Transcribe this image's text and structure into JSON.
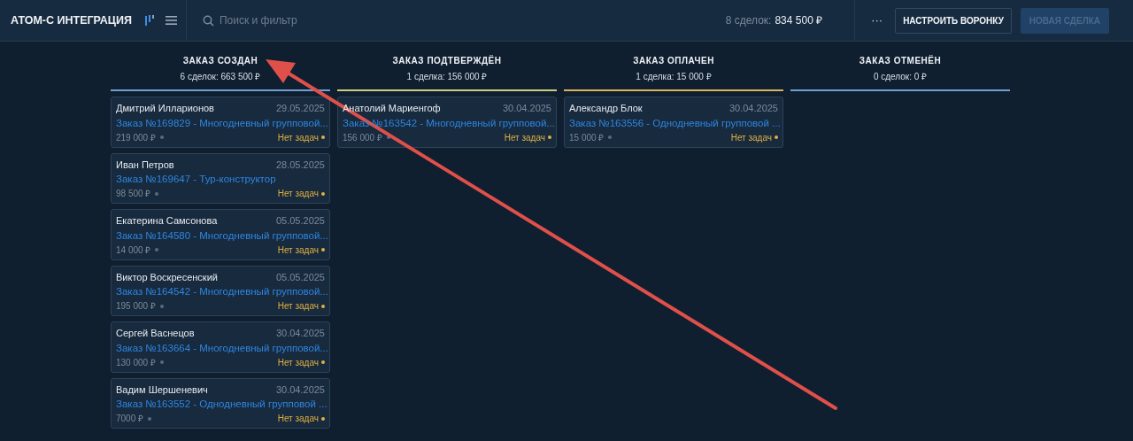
{
  "header": {
    "title": "АТОМ-С ИНТЕГРАЦИЯ",
    "search": {
      "placeholder": "Поиск и фильтр"
    },
    "summary_label": "8 сделок:",
    "summary_value": "834 500 ₽",
    "more": "···",
    "buttons": [
      {
        "label": "НАСТРОИТЬ ВОРОНКУ",
        "disabled": false
      },
      {
        "label": "НОВАЯ СДЕЛКА",
        "disabled": true
      }
    ]
  },
  "columns": [
    {
      "title": "ЗАКАЗ СОЗДАН",
      "summary": "6 сделок: 663 500 ₽",
      "color": "#6f9fd4",
      "cards": [
        {
          "name": "Дмитрий Илларионов",
          "date": "29.05.2025",
          "order": "Заказ №169829 - Многодневный групповой...",
          "amount": "219 000 ₽",
          "tasks": "Нет задач"
        },
        {
          "name": "Иван Петров",
          "date": "28.05.2025",
          "order": "Заказ №169647 - Тур-конструктор",
          "amount": "98 500 ₽",
          "tasks": "Нет задач"
        },
        {
          "name": "Екатерина Самсонова",
          "date": "05.05.2025",
          "order": "Заказ №164580 - Многодневный групповой...",
          "amount": "14 000 ₽",
          "tasks": "Нет задач"
        },
        {
          "name": "Виктор Воскресенский",
          "date": "05.05.2025",
          "order": "Заказ №164542 - Многодневный групповой...",
          "amount": "195 000 ₽",
          "tasks": "Нет задач"
        },
        {
          "name": "Сергей Васнецов",
          "date": "30.04.2025",
          "order": "Заказ №163664 - Многодневный групповой...",
          "amount": "130 000 ₽",
          "tasks": "Нет задач"
        },
        {
          "name": "Вадим Шершеневич",
          "date": "30.04.2025",
          "order": "Заказ №163552 - Однодневный групповой ...",
          "amount": "7000 ₽",
          "tasks": "Нет задач"
        }
      ]
    },
    {
      "title": "ЗАКАЗ ПОДТВЕРЖДЁН",
      "summary": "1 сделка: 156 000 ₽",
      "color": "#c9cf7e",
      "cards": [
        {
          "name": "Анатолий Мариенгоф",
          "date": "30.04.2025",
          "order": "Заказ №163542 - Многодневный групповой...",
          "amount": "156 000 ₽",
          "tasks": "Нет задач"
        }
      ]
    },
    {
      "title": "ЗАКАЗ ОПЛАЧЕН",
      "summary": "1 сделка: 15 000 ₽",
      "color": "#d9b45e",
      "cards": [
        {
          "name": "Александр Блок",
          "date": "30.04.2025",
          "order": "Заказ №163556 - Однодневный групповой ...",
          "amount": "15 000 ₽",
          "tasks": "Нет задач"
        }
      ]
    },
    {
      "title": "ЗАКАЗ ОТМЕНЁН",
      "summary": "0 сделок: 0 ₽",
      "color": "#6f9fd4"
    }
  ]
}
